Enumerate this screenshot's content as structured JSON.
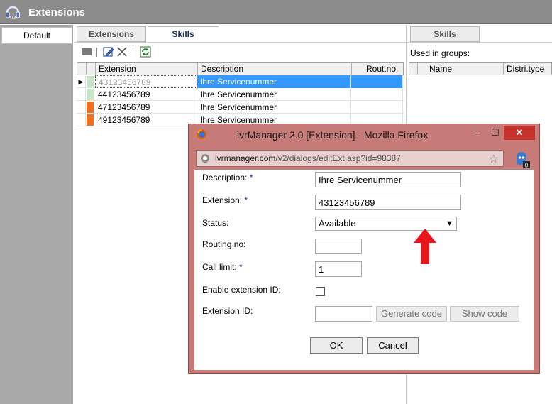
{
  "app": {
    "title": "Extensions",
    "icon": "app-headset-icon"
  },
  "left": {
    "tab_label": "Default"
  },
  "middle": {
    "tabs": [
      {
        "label": "Extensions"
      },
      {
        "label": "Skills"
      }
    ],
    "toolbar": [
      "stop-icon",
      "edit-icon",
      "delete-icon",
      "refresh-icon"
    ],
    "columns": [
      "Extension",
      "Description",
      "Rout.no."
    ],
    "rows": [
      {
        "extension": "43123456789",
        "description": "Ihre Servicenummer",
        "rout": "",
        "status_color": "#c6e6c6",
        "selected": true
      },
      {
        "extension": "44123456789",
        "description": "Ihre Servicenummer",
        "rout": "",
        "status_color": "#c6e6c6",
        "selected": false
      },
      {
        "extension": "47123456789",
        "description": "Ihre Servicenummer",
        "rout": "",
        "status_color": "#f07020",
        "selected": false
      },
      {
        "extension": "49123456789",
        "description": "Ihre Servicenummer",
        "rout": "",
        "status_color": "#f07020",
        "selected": false
      }
    ]
  },
  "right": {
    "tab_label": "Skills",
    "used_in_groups_label": "Used in groups:",
    "columns": [
      "Name",
      "Distri.type"
    ]
  },
  "popup": {
    "title": "ivrManager 2.0 [Extension] - Mozilla Firefox",
    "min_label": "–",
    "max_label": "☐",
    "close_label": "✕",
    "url_domain": "ivrmanager.com",
    "url_path": "/v2/dialogs/editExt.asp?id=98387",
    "addon_badge": "0",
    "form": {
      "description_label": "Description:",
      "description_value": "Ihre Servicenummer",
      "extension_label": "Extension:",
      "extension_value": "43123456789",
      "status_label": "Status:",
      "status_value": "Available",
      "routing_label": "Routing no:",
      "routing_value": "",
      "call_limit_label": "Call limit:",
      "call_limit_value": "1",
      "enable_ext_id_label": "Enable extension ID:",
      "enable_ext_id_checked": false,
      "ext_id_label": "Extension ID:",
      "ext_id_value": "",
      "generate_code_label": "Generate code",
      "show_code_label": "Show code",
      "ok_label": "OK",
      "cancel_label": "Cancel",
      "required_mark": "*"
    }
  },
  "colors": {
    "title_bar": "#8c8c8c",
    "popup_frame": "#c77b79",
    "selection": "#3399ff",
    "annotation_arrow": "#e8161b"
  }
}
